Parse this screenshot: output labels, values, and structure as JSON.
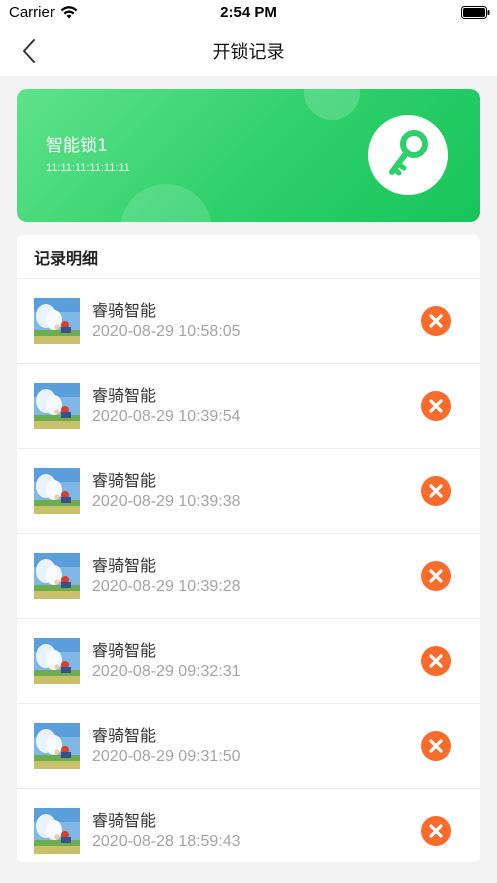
{
  "status_bar": {
    "carrier": "Carrier",
    "time": "2:54 PM",
    "icons": [
      "wifi-icon",
      "battery-icon"
    ]
  },
  "nav": {
    "title": "开锁记录",
    "back_icon": "back-chevron-icon"
  },
  "lock_card": {
    "name": "智能锁1",
    "id": "11:11:11:11:11:11",
    "icon": "key-icon",
    "colors": {
      "gradient_start": "#5fe28a",
      "gradient_end": "#17c45a",
      "key": "#2ed06b"
    }
  },
  "records": {
    "title": "记录明细",
    "delete_color": "#fa6b2c",
    "items": [
      {
        "name": "睿骑智能",
        "time": "2020-08-29 10:58:05"
      },
      {
        "name": "睿骑智能",
        "time": "2020-08-29 10:39:54"
      },
      {
        "name": "睿骑智能",
        "time": "2020-08-29 10:39:38"
      },
      {
        "name": "睿骑智能",
        "time": "2020-08-29 10:39:28"
      },
      {
        "name": "睿骑智能",
        "time": "2020-08-29 09:32:31"
      },
      {
        "name": "睿骑智能",
        "time": "2020-08-29 09:31:50"
      },
      {
        "name": "睿骑智能",
        "time": "2020-08-28 18:59:43"
      }
    ]
  }
}
